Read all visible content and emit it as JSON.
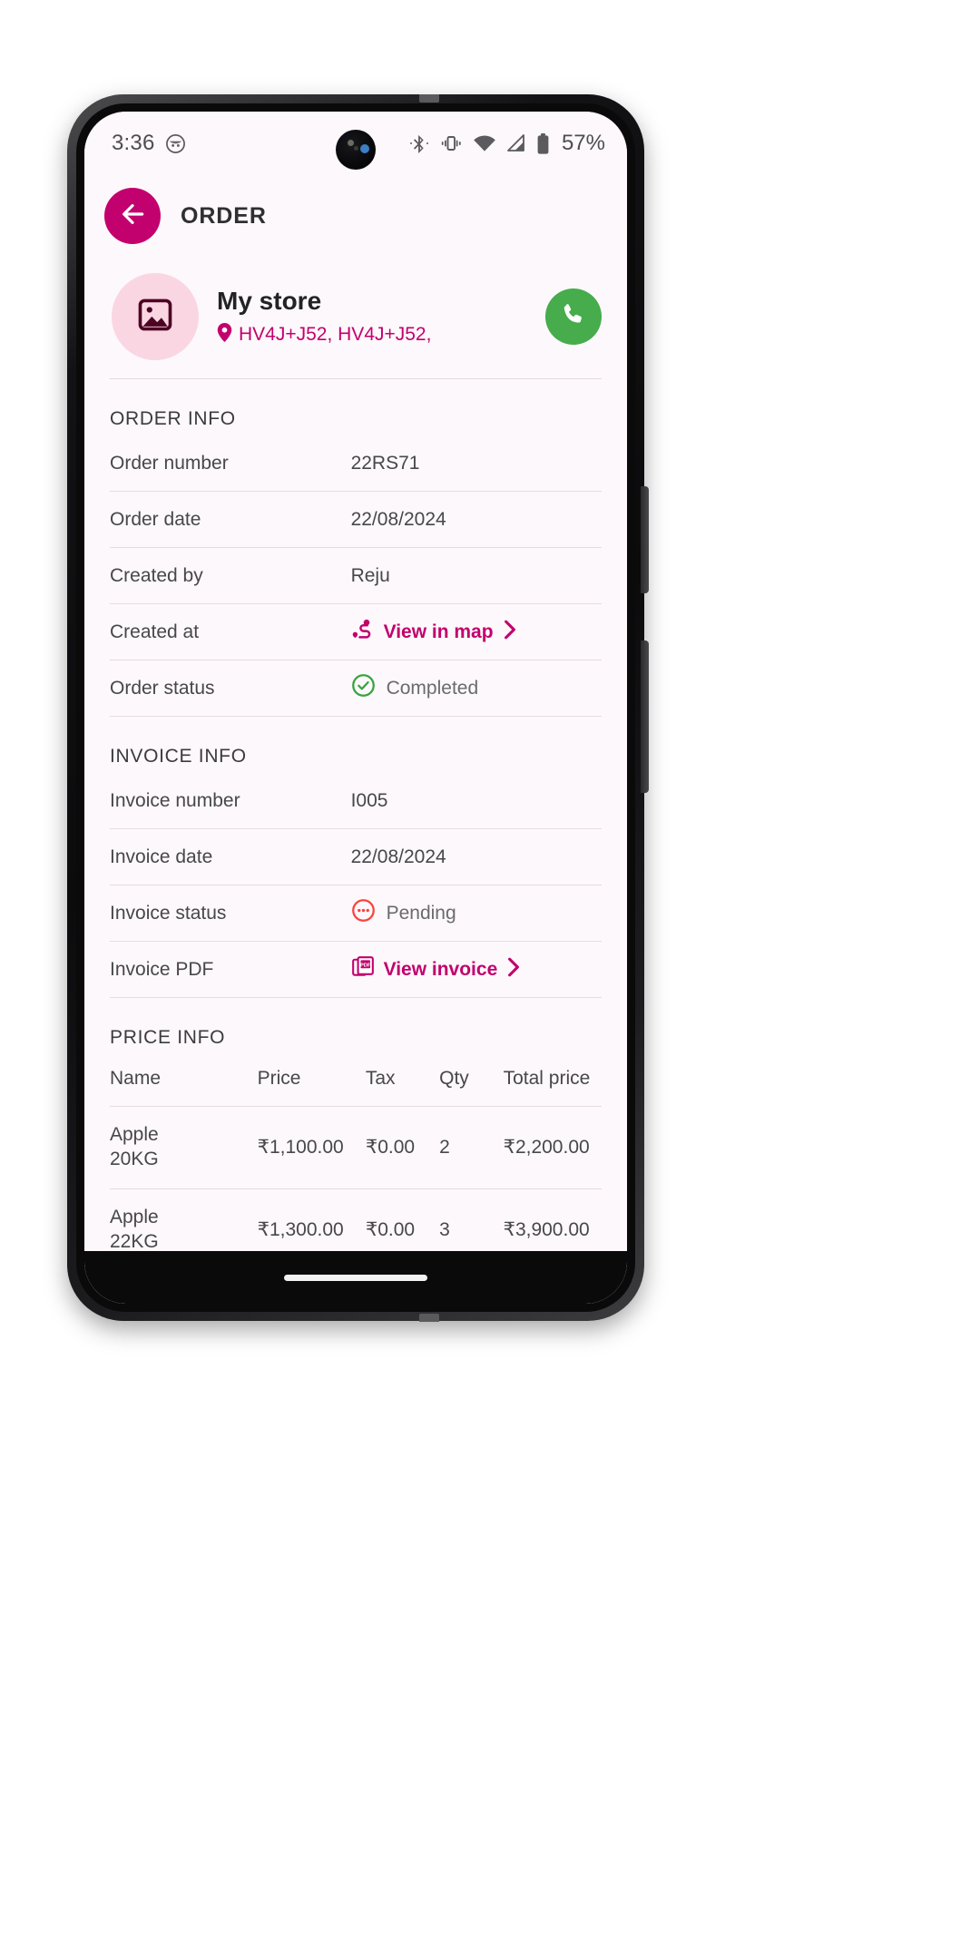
{
  "status_bar": {
    "time": "3:36",
    "battery_percent": "57%",
    "icons": [
      "notification-icon",
      "bluetooth-icon",
      "vibrate-icon",
      "wifi-icon",
      "cellular-signal-icon",
      "battery-icon"
    ]
  },
  "appbar": {
    "title": "ORDER",
    "back_icon": "arrow-left-icon"
  },
  "store": {
    "name": "My store",
    "address": "HV4J+J52, HV4J+J52,",
    "avatar_icon": "image-placeholder-icon",
    "call_icon": "phone-icon"
  },
  "order_info": {
    "section_title": "ORDER INFO",
    "rows": [
      {
        "label": "Order number",
        "value": "22RS71",
        "kind": "text"
      },
      {
        "label": "Order date",
        "value": "22/08/2024",
        "kind": "text"
      },
      {
        "label": "Created by",
        "value": "Reju",
        "kind": "text"
      },
      {
        "label": "Created at",
        "value": "View in map",
        "kind": "link",
        "icon": "map-route-icon"
      },
      {
        "label": "Order status",
        "value": "Completed",
        "kind": "status",
        "icon": "check-circle-icon"
      }
    ]
  },
  "invoice_info": {
    "section_title": "INVOICE INFO",
    "rows": [
      {
        "label": "Invoice number",
        "value": "I005",
        "kind": "text"
      },
      {
        "label": "Invoice date",
        "value": "22/08/2024",
        "kind": "text"
      },
      {
        "label": "Invoice status",
        "value": "Pending",
        "kind": "status",
        "icon": "pending-circle-icon"
      },
      {
        "label": "Invoice PDF",
        "value": "View invoice",
        "kind": "link",
        "icon": "pdf-icon"
      }
    ]
  },
  "price_info": {
    "section_title": "PRICE INFO",
    "columns": [
      "Name",
      "Price",
      "Tax",
      "Qty",
      "Total price"
    ],
    "rows": [
      {
        "name": "Apple\n20KG",
        "price": "₹1,100.00",
        "tax": "₹0.00",
        "qty": "2",
        "total": "₹2,200.00"
      },
      {
        "name": "Apple\n22KG",
        "price": "₹1,300.00",
        "tax": "₹0.00",
        "qty": "3",
        "total": "₹3,900.00"
      }
    ]
  },
  "colors": {
    "brand_magenta": "#c2006e",
    "avatar_pink": "#fad6e3",
    "call_green": "#46ac4c",
    "status_completed_green": "#35a53d",
    "status_pending_red": "#f8443c",
    "screen_bg": "#fdf8fb",
    "divider": "#ead9e1",
    "text_primary": "#232327",
    "text_secondary": "#47474c"
  }
}
